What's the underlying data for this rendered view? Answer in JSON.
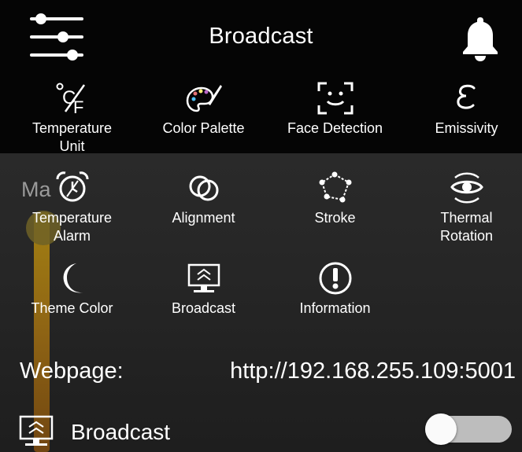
{
  "header": {
    "title": "Broadcast"
  },
  "menu_items": [
    {
      "id": "temperature-unit",
      "label": "Temperature\nUnit",
      "icon": "temperature-unit-icon"
    },
    {
      "id": "color-palette",
      "label": "Color Palette",
      "icon": "palette-icon"
    },
    {
      "id": "face-detection",
      "label": "Face Detection",
      "icon": "face-detection-icon"
    },
    {
      "id": "emissivity",
      "label": "Emissivity",
      "icon": "emissivity-icon"
    },
    {
      "id": "temperature-alarm",
      "label": "Temperature\nAlarm",
      "icon": "alarm-clock-icon"
    },
    {
      "id": "alignment",
      "label": "Alignment",
      "icon": "alignment-icon"
    },
    {
      "id": "stroke",
      "label": "Stroke",
      "icon": "stroke-icon"
    },
    {
      "id": "thermal-rotation",
      "label": "Thermal\nRotation",
      "icon": "rotation-eye-icon"
    },
    {
      "id": "theme-color",
      "label": "Theme Color",
      "icon": "moon-icon"
    },
    {
      "id": "broadcast",
      "label": "Broadcast",
      "icon": "broadcast-monitor-icon"
    },
    {
      "id": "information",
      "label": "Information",
      "icon": "info-icon"
    }
  ],
  "background": {
    "partial_label": "Ma"
  },
  "webpage": {
    "label": "Webpage:",
    "url": "http://192.168.255.109:5001"
  },
  "broadcast_setting": {
    "label": "Broadcast",
    "toggle_on": false
  },
  "colors": {
    "background": "#000000",
    "panel": "#262626",
    "toggle_track": "#bdbdbd",
    "slider": "#b08a10"
  }
}
